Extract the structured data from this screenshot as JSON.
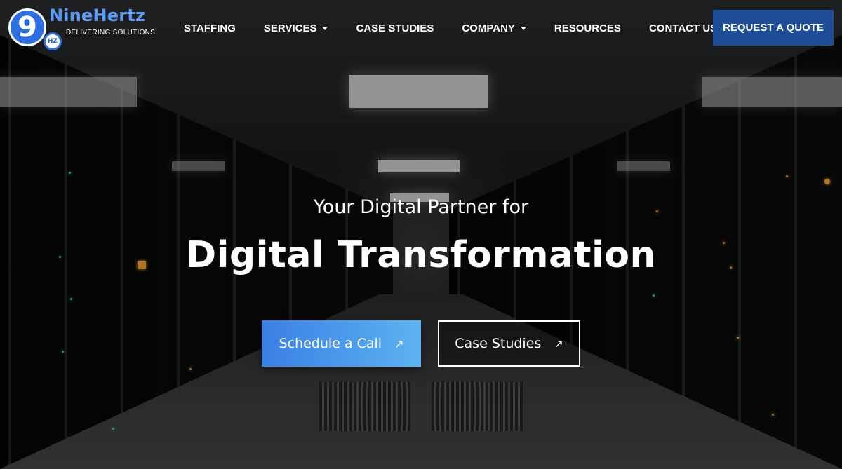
{
  "brand": {
    "logo_mark": "9",
    "logo_badge": "HZ",
    "name": "NineHertz",
    "tagline": "DELIVERING SOLUTIONS"
  },
  "nav": {
    "items": [
      {
        "label": "STAFFING",
        "dropdown": false
      },
      {
        "label": "SERVICES",
        "dropdown": true
      },
      {
        "label": "CASE STUDIES",
        "dropdown": false
      },
      {
        "label": "COMPANY",
        "dropdown": true
      },
      {
        "label": "RESOURCES",
        "dropdown": false
      },
      {
        "label": "CONTACT US",
        "dropdown": false
      }
    ],
    "cta_label": "REQUEST A QUOTE"
  },
  "hero": {
    "subtitle": "Your Digital Partner for",
    "title": "Digital Transformation",
    "primary_button": {
      "label": "Schedule a Call",
      "icon": "arrow-up-right-icon"
    },
    "secondary_button": {
      "label": "Case Studies",
      "icon": "arrow-up-right-icon"
    }
  },
  "colors": {
    "accent": "#1f4e98",
    "logo_blue": "#2d6fe0",
    "primary_gradient_start": "#3b7fe6",
    "primary_gradient_end": "#5cb3f0"
  }
}
